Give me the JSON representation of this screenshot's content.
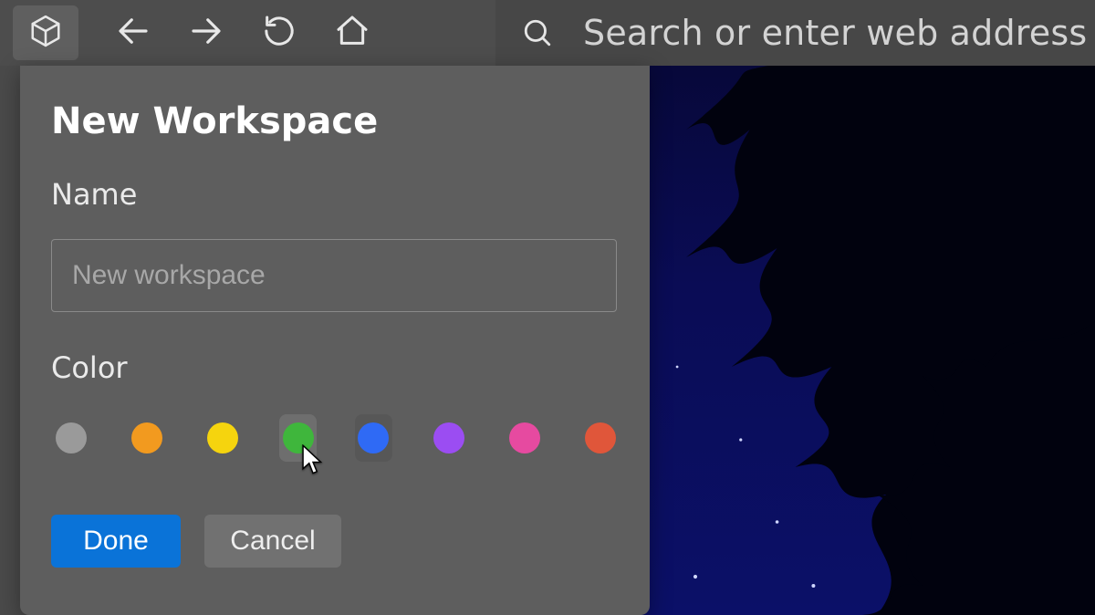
{
  "toolbar": {
    "search_placeholder": "Search or enter web address"
  },
  "panel": {
    "title": "New Workspace",
    "name_label": "Name",
    "name_placeholder": "New workspace",
    "name_value": "",
    "color_label": "Color",
    "colors": [
      {
        "name": "gray",
        "hex": "#9a9a9a"
      },
      {
        "name": "orange",
        "hex": "#f29a1f"
      },
      {
        "name": "yellow",
        "hex": "#f5d40e"
      },
      {
        "name": "green",
        "hex": "#3fb63c"
      },
      {
        "name": "blue",
        "hex": "#2f6af5"
      },
      {
        "name": "purple",
        "hex": "#9b4df2"
      },
      {
        "name": "pink",
        "hex": "#e64aa0"
      },
      {
        "name": "red",
        "hex": "#e0563a"
      }
    ],
    "hover_index": 3,
    "buttons": {
      "done": "Done",
      "cancel": "Cancel"
    }
  }
}
